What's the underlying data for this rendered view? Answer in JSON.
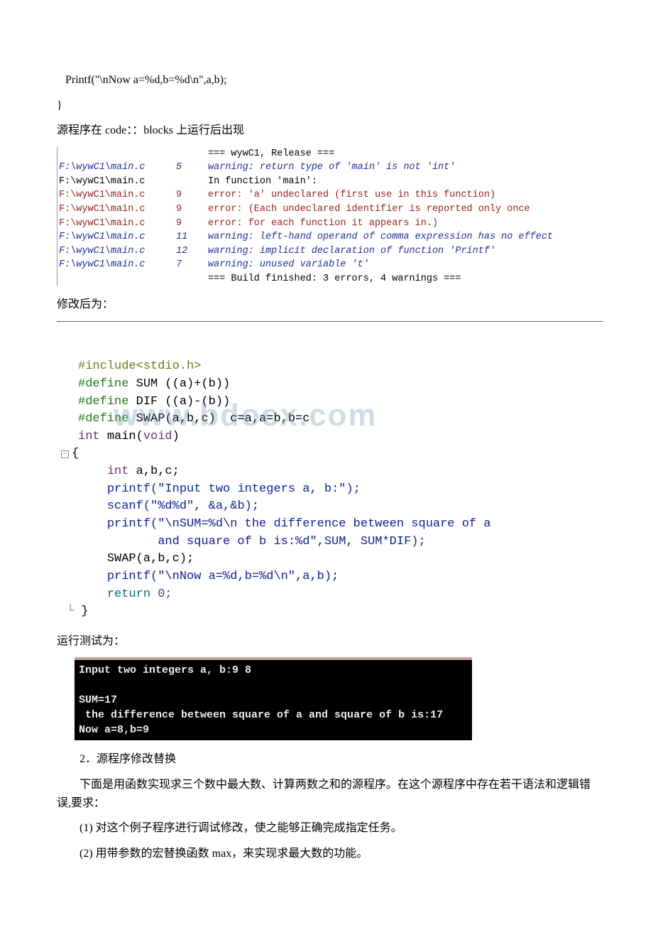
{
  "top_code": {
    "line1": "Printf(\"\\nNow a=%d,b=%d\\n\",a,b);",
    "line2": "}"
  },
  "text1": "源程序在 code：：blocks 上运行后出现",
  "compiler": {
    "rows": [
      {
        "file": "",
        "num": "",
        "msg": "=== wywC1, Release ===",
        "cls": "cblack"
      },
      {
        "file": "F:\\wywC1\\main.c",
        "num": "5",
        "msg": "warning: return type of 'main' is not 'int'",
        "cls": "cblue"
      },
      {
        "file": "F:\\wywC1\\main.c",
        "num": "",
        "msg": "In function 'main':",
        "cls": "cblack"
      },
      {
        "file": "F:\\wywC1\\main.c",
        "num": "9",
        "msg": "error: 'a' undeclared (first use in this function)",
        "cls": "cred"
      },
      {
        "file": "F:\\wywC1\\main.c",
        "num": "9",
        "msg": "error: (Each undeclared identifier is reported only once",
        "cls": "cred"
      },
      {
        "file": "F:\\wywC1\\main.c",
        "num": "9",
        "msg": "error: for each function it appears in.)",
        "cls": "cred"
      },
      {
        "file": "F:\\wywC1\\main.c",
        "num": "11",
        "msg": "warning: left-hand operand of comma expression has no effect",
        "cls": "cblue"
      },
      {
        "file": "F:\\wywC1\\main.c",
        "num": "12",
        "msg": "warning: implicit declaration of function 'Printf'",
        "cls": "cblue"
      },
      {
        "file": "F:\\wywC1\\main.c",
        "num": "7",
        "msg": "warning: unused variable 't'",
        "cls": "cblue"
      },
      {
        "file": "",
        "num": "",
        "msg": "=== Build finished: 3 errors, 4 warnings ===",
        "cls": "cblack"
      }
    ]
  },
  "text2": "修改后为：",
  "watermark": "www.bdocx.com",
  "text3": "运行测试为：",
  "console": {
    "lines": [
      "Input two integers a, b:9 8",
      "",
      "SUM=17",
      " the difference between square of a and square of b is:17",
      "Now a=8,b=9"
    ]
  },
  "text4": "2．源程序修改替换",
  "text5": "下面是用函数实现求三个数中最大数、计算两数之和的源程序。在这个源程序中存在若干语法和逻辑错误,要求：",
  "text6": "(1) 对这个例子程序进行调试修改，使之能够正确完成指定任务。",
  "text7": "(2) 用带参数的宏替换函数 max，来实现求最大数的功能。",
  "code": {
    "include": "#include<stdio.h>",
    "def1a": "#define",
    "def1b": " SUM ((a)+(b))",
    "def2a": "#define",
    "def2b": " DIF ((a)-(b))",
    "def3a": "#define",
    "def3b": " SWAP(a,b,c)  c=a,a=b,b=c",
    "int": "int",
    "mainw": "main",
    "voidw": "void",
    "intdecl": "int",
    "abc": " a,b,c;",
    "printf1": "printf",
    "str1": "(\"Input two integers a, b:\");",
    "scanf": "scanf",
    "str2": "(\"%d%d\", &a,&b);",
    "printf2": "printf",
    "str3a": "(\"\\nSUM=%d\\n the difference between square of a",
    "str3b": "           and square of b is:%d\",SUM, SUM*DIF);",
    "swap": "SWAP",
    "swapargs": "(a,b,c);",
    "printf3": "printf",
    "str4": "(\"\\nNow a=%d,b=%d\\n\",a,b);",
    "return": "return",
    "zero": " 0;",
    "lbrace": "{",
    "rbrace": "}"
  }
}
